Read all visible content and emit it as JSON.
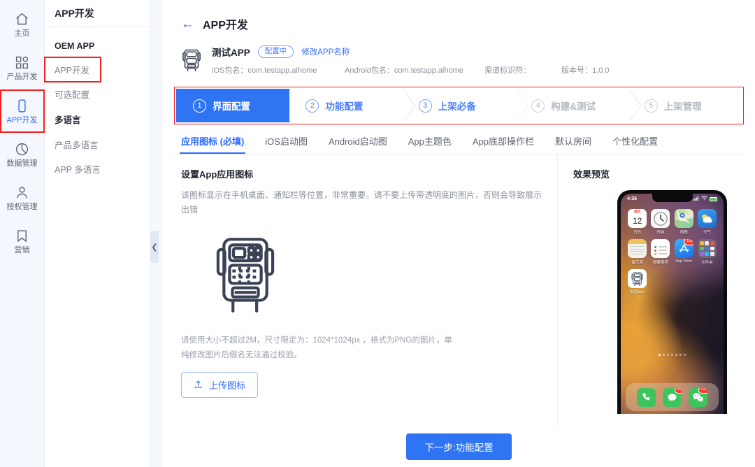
{
  "rail": {
    "items": [
      {
        "label": "主页",
        "icon": "home-icon",
        "active": false
      },
      {
        "label": "产品开发",
        "icon": "grid-icon",
        "active": false
      },
      {
        "label": "APP开发",
        "icon": "phone-icon",
        "active": true
      },
      {
        "label": "数据管理",
        "icon": "pie-chart-icon",
        "active": false
      },
      {
        "label": "授权管理",
        "icon": "user-icon",
        "active": false
      },
      {
        "label": "营销",
        "icon": "bookmark-icon",
        "active": false
      }
    ]
  },
  "submenu": {
    "title": "APP开发",
    "groups": [
      {
        "label": "OEM APP",
        "items": [
          "APP开发",
          "可选配置"
        ]
      },
      {
        "label": "多语言",
        "items": [
          "产品多语言",
          "APP 多语言"
        ]
      }
    ],
    "selected": "APP开发",
    "collapse_icon": "chevron-left-icon"
  },
  "page": {
    "back_icon": "arrow-left-icon",
    "title": "APP开发"
  },
  "appinfo": {
    "icon": "machine-icon",
    "name": "测试APP",
    "status_badge": "配置中",
    "rename_link": "修改APP名称",
    "ios_package": "iOS包名：com.testapp.aihome",
    "android_package": "Android包名：com.testapp.aihome",
    "channel_id": "渠道标识符：",
    "version": "版本号：1.0.0"
  },
  "steps": [
    {
      "num": "1",
      "label": "界面配置",
      "state": "current"
    },
    {
      "num": "2",
      "label": "功能配置",
      "state": "done"
    },
    {
      "num": "3",
      "label": "上架必备",
      "state": "done"
    },
    {
      "num": "4",
      "label": "构建&测试",
      "state": "inactive"
    },
    {
      "num": "5",
      "label": "上架管理",
      "state": "inactive"
    }
  ],
  "tabs": [
    {
      "label": "应用图标 (必填)",
      "active": true
    },
    {
      "label": "iOS启动图",
      "active": false
    },
    {
      "label": "Android启动图",
      "active": false
    },
    {
      "label": "App主题色",
      "active": false
    },
    {
      "label": "App底部操作栏",
      "active": false
    },
    {
      "label": "默认房间",
      "active": false
    },
    {
      "label": "个性化配置",
      "active": false
    }
  ],
  "content": {
    "section_title": "设置App应用图标",
    "section_desc": "该图标显示在手机桌面、通知栏等位置，非常重要。请不要上传带透明底的图片，否则会导致展示出错",
    "placeholder_icon": "machine-icon",
    "hint": "请使用大小不超过2M，尺寸限定为：1024*1024px ，格式为PNG的图片，单纯修改图片后缀名无法通过校验。",
    "upload_icon": "upload-icon",
    "upload_label": "上传图标"
  },
  "preview": {
    "title": "效果预览",
    "status_time": "4:36",
    "status_wifi_icon": "wifi-icon",
    "status_battery_icon": "battery-icon",
    "apps": [
      {
        "label": "日历",
        "glyph": "12",
        "kind": "calendar"
      },
      {
        "label": "时钟",
        "glyph": "",
        "kind": "clock"
      },
      {
        "label": "地图",
        "glyph": "",
        "kind": "maps"
      },
      {
        "label": "天气",
        "glyph": "",
        "kind": "weather"
      },
      {
        "label": "备忘录",
        "glyph": "",
        "kind": "notes"
      },
      {
        "label": "提醒事项",
        "glyph": "",
        "kind": "reminders"
      },
      {
        "label": "App Store",
        "glyph": "A",
        "kind": "appstore",
        "badge": "158"
      },
      {
        "label": "文件夹",
        "glyph": "",
        "kind": "folder"
      },
      {
        "label": "测试APP",
        "glyph": "",
        "kind": "testapp"
      }
    ],
    "dock": [
      {
        "label": "电话",
        "kind": "phone",
        "badge": ""
      },
      {
        "label": "信息",
        "kind": "messages",
        "badge": "93"
      },
      {
        "label": "微信",
        "kind": "wechat",
        "badge": "228"
      }
    ]
  },
  "footer": {
    "next_label": "下一步:功能配置"
  },
  "colors": {
    "accent": "#2f6bff",
    "primary_button": "#2f74f2",
    "highlight_box": "#f4201f",
    "rail_bg": "#f4f7fd",
    "muted_text": "#8a909b"
  }
}
